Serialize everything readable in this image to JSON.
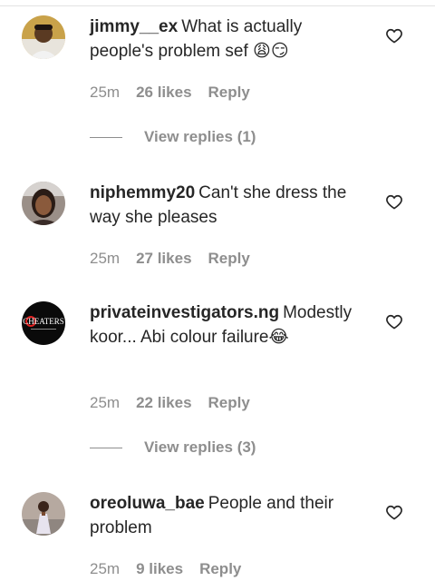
{
  "comments": [
    {
      "username": "jimmy__ex",
      "text": "What is actually people's problem sef 😩😏",
      "time": "25m",
      "likes": "26 likes",
      "reply": "Reply",
      "view_replies": "View replies (1)"
    },
    {
      "username": "niphemmy20",
      "text": "Can't she dress the way she pleases",
      "time": "25m",
      "likes": "27 likes",
      "reply": "Reply"
    },
    {
      "username": "privateinvestigators.ng",
      "text": "Modestly koor... Abi colour failure😂",
      "time": "25m",
      "likes": "22 likes",
      "reply": "Reply",
      "view_replies": "View replies (3)"
    },
    {
      "username": "oreoluwa_bae",
      "text": "People and their problem",
      "time": "25m",
      "likes": "9 likes",
      "reply": "Reply"
    }
  ],
  "avatar_logo_text": "CHEATERS",
  "colors": {
    "text": "#262626",
    "secondary": "#8e8e8e"
  },
  "icons": {
    "like": "heart-icon"
  }
}
